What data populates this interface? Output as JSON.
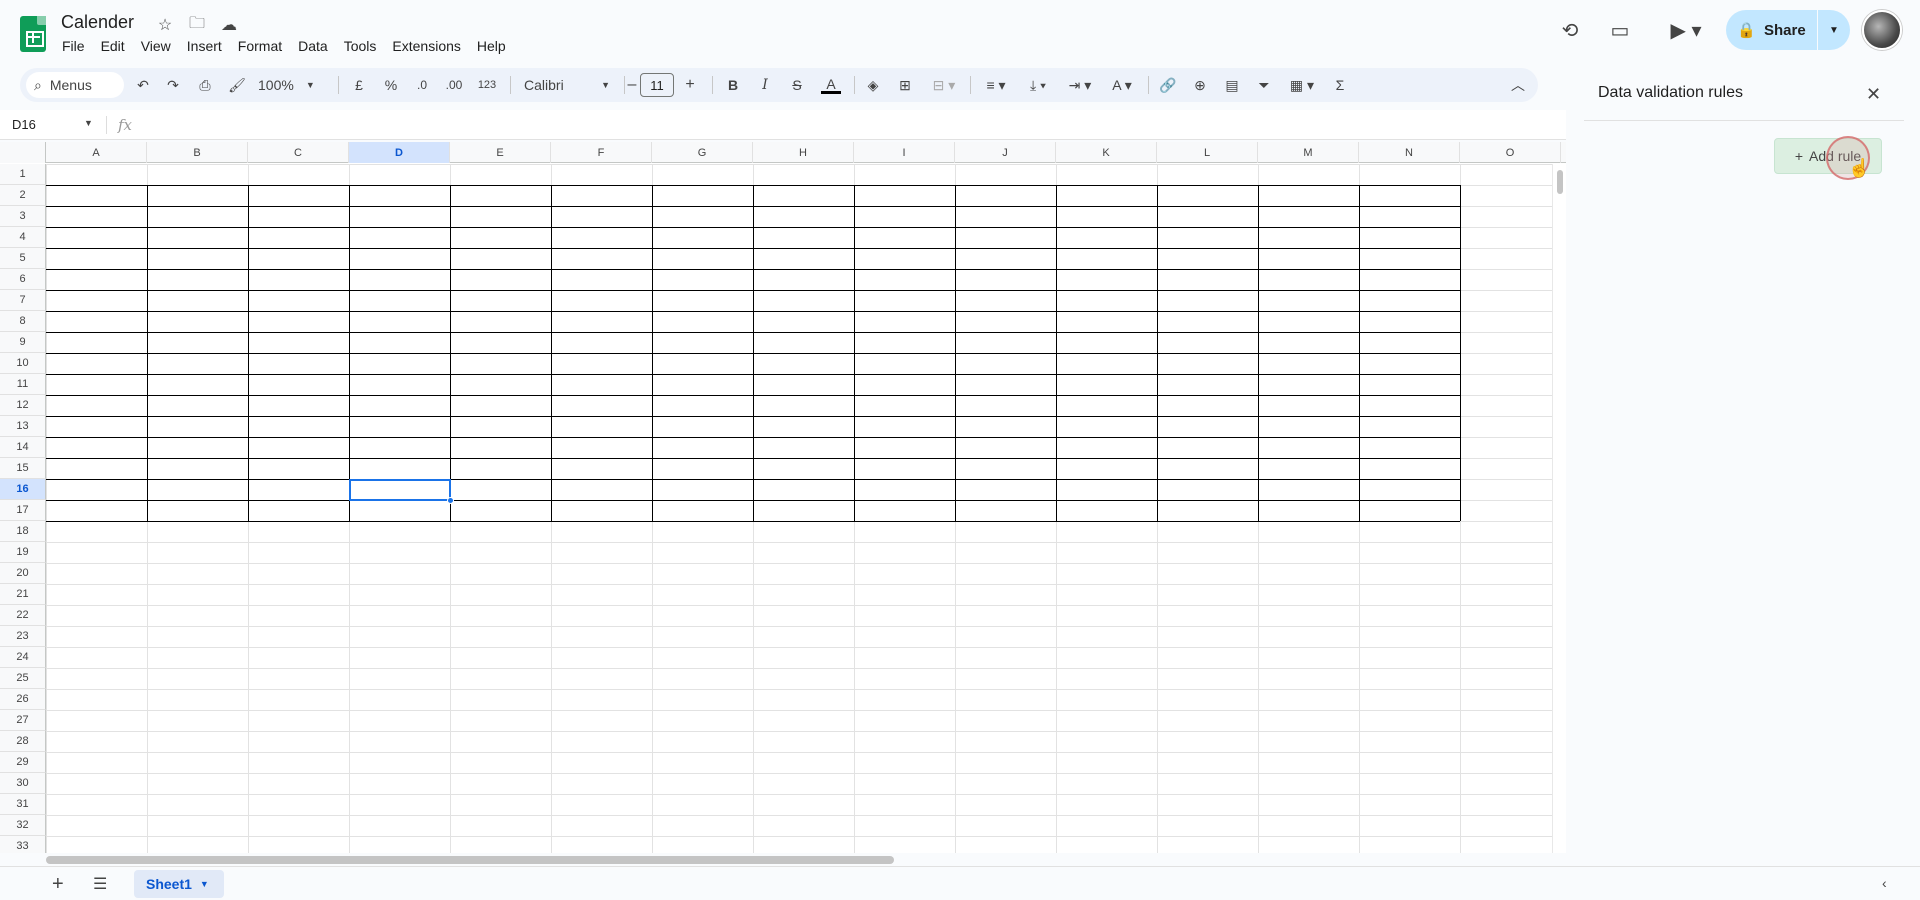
{
  "title_bar": {
    "doc_title": "Calender",
    "menu": [
      "File",
      "Edit",
      "View",
      "Insert",
      "Format",
      "Data",
      "Tools",
      "Extensions",
      "Help"
    ],
    "share_label": "Share"
  },
  "toolbar": {
    "search_label": "Menus",
    "zoom": "100%",
    "currency": "£",
    "percent": "%",
    "dec_less": ".0",
    "dec_more": ".00",
    "number_format": "123",
    "font": "Calibri",
    "font_size": "11"
  },
  "formula_bar": {
    "cell_ref": "D16",
    "fx": "fx"
  },
  "grid": {
    "columns": [
      "A",
      "B",
      "C",
      "D",
      "E",
      "F",
      "G",
      "H",
      "I",
      "J",
      "K",
      "L",
      "M",
      "N",
      "O"
    ],
    "rows": [
      "1",
      "2",
      "3",
      "4",
      "5",
      "6",
      "7",
      "8",
      "9",
      "10",
      "11",
      "12",
      "13",
      "14",
      "15",
      "16",
      "17",
      "18",
      "19",
      "20",
      "21",
      "22",
      "23",
      "24",
      "25",
      "26",
      "27",
      "28",
      "29",
      "30",
      "31",
      "32",
      "33"
    ],
    "selected_column": "D",
    "selected_row": "16"
  },
  "sheets": {
    "active": "Sheet1"
  },
  "side_panel": {
    "title": "Data validation rules",
    "add_rule_label": "Add rule"
  }
}
